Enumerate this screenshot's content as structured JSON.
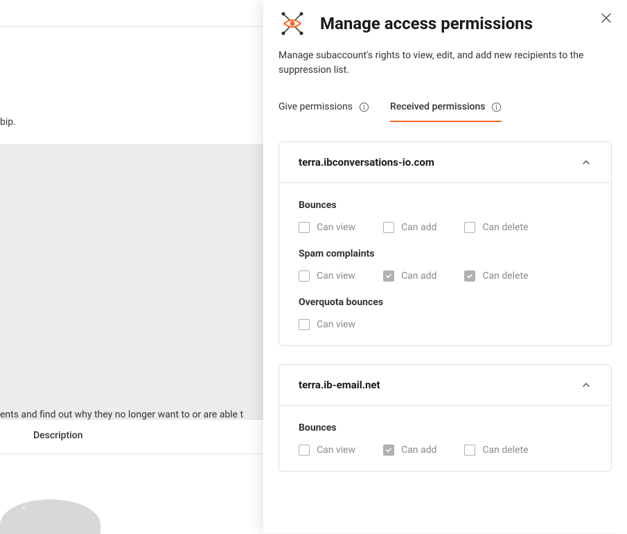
{
  "background": {
    "fragment1": "bip.",
    "fragment2": "ents and find out why they no longer want to or are able t",
    "descriptionTab": "Description"
  },
  "panel": {
    "title": "Manage access permissions",
    "subtitle": "Manage subaccount's rights to view, edit, and add new recipients to the suppression list.",
    "tabs": {
      "give": "Give permissions",
      "received": "Received permissions"
    },
    "labels": {
      "canView": "Can view",
      "canAdd": "Can add",
      "canDelete": "Can delete"
    },
    "sections": {
      "bounces": "Bounces",
      "spam": "Spam complaints",
      "overquota": "Overquota bounces"
    },
    "accounts": [
      {
        "domain": "terra.ibconversations-io.com",
        "bounces": {
          "view": false,
          "add": false,
          "delete": false
        },
        "spam": {
          "view": false,
          "add": true,
          "delete": true
        },
        "overquota": {
          "view": false
        }
      },
      {
        "domain": "terra.ib-email.net",
        "bounces": {
          "view": false,
          "add": true,
          "delete": false
        }
      }
    ]
  }
}
